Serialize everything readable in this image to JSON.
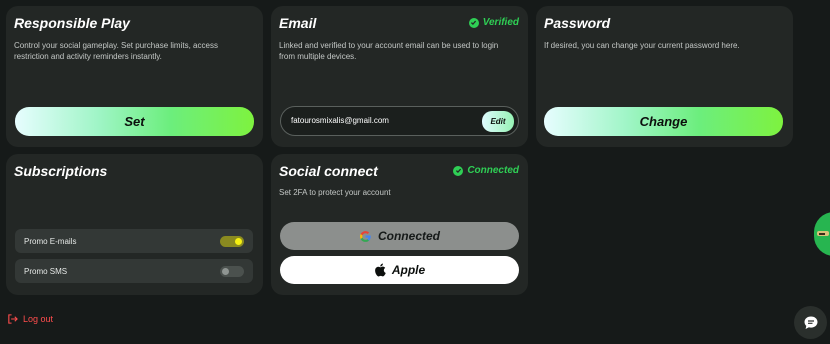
{
  "responsible_play": {
    "title": "Responsible Play",
    "description": "Control your social gameplay. Set purchase limits, access restriction and activity reminders instantly.",
    "button_label": "Set"
  },
  "email": {
    "title": "Email",
    "status": "Verified",
    "description": "Linked and verified to your account email can be used to login from multiple devices.",
    "value": "fatourosmixalis@gmail.com",
    "edit_label": "Edit"
  },
  "password": {
    "title": "Password",
    "description": "If desired, you can change your current password here.",
    "button_label": "Change"
  },
  "subscriptions": {
    "title": "Subscriptions",
    "items": [
      {
        "label": "Promo E-mails",
        "enabled": true
      },
      {
        "label": "Promo SMS",
        "enabled": false
      }
    ]
  },
  "social_connect": {
    "title": "Social connect",
    "status": "Connected",
    "description": "Set 2FA to protect your account",
    "google_label": "Connected",
    "apple_label": "Apple"
  },
  "logout_label": "Log out",
  "colors": {
    "accent_green": "#2fcf55",
    "toggle_on": "#d4d20f",
    "logout_red": "#ff4d4d",
    "card_bg": "#232725",
    "page_bg": "#161a19"
  },
  "icons": [
    "check-circle-icon",
    "google-icon",
    "apple-icon",
    "logout-icon",
    "chat-icon"
  ]
}
